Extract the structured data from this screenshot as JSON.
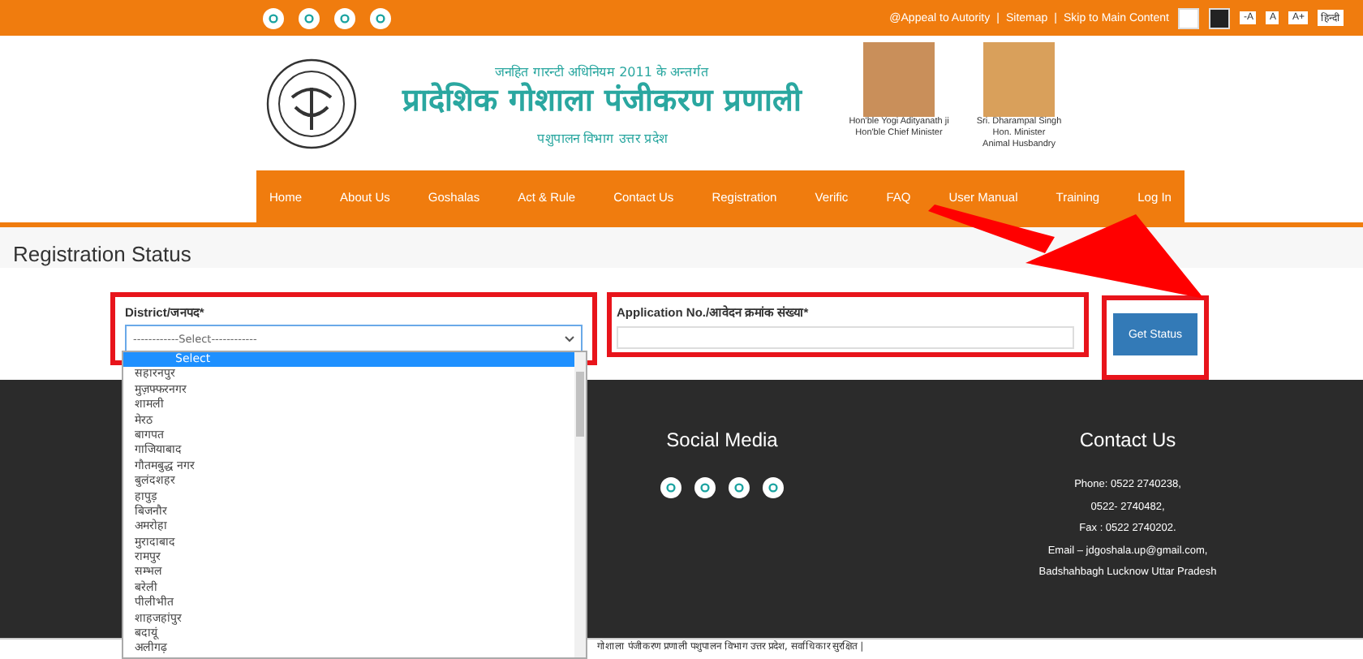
{
  "top_bar": {
    "links": [
      {
        "label": "@Appeal to Autority"
      },
      {
        "label": "Sitemap"
      },
      {
        "label": "Skip to Main Content"
      }
    ],
    "separators": [
      "|",
      "|"
    ],
    "themes": [
      {
        "color": "#ffffff"
      },
      {
        "color": "#222222"
      }
    ],
    "font_buttons": [
      "-A",
      "A",
      "A+"
    ],
    "language": "हिन्दी"
  },
  "header": {
    "act_line": "जनहित गारन्टी अधिनियम 2011 के अन्तर्गत",
    "title": "प्रादेशिक गोशाला पंजीकरण प्रणाली",
    "department": "पशुपालन विभाग उत्तर प्रदेश",
    "officials": [
      {
        "lines": [
          "Hon'ble Yogi Adityanath ji",
          "Hon'ble Chief Minister"
        ]
      },
      {
        "lines": [
          "Sri. Dharampal Singh",
          "Hon. Minister",
          "Animal Husbandry"
        ]
      }
    ]
  },
  "nav": [
    {
      "label": "Home"
    },
    {
      "label": "About Us"
    },
    {
      "label": "Goshalas"
    },
    {
      "label": "Act & Rule"
    },
    {
      "label": "Contact Us"
    },
    {
      "label": "Registration"
    },
    {
      "label": "Verific"
    },
    {
      "label": "FAQ"
    },
    {
      "label": "User Manual"
    },
    {
      "label": "Training"
    },
    {
      "label": "Log In"
    }
  ],
  "page_title": "Registration Status",
  "form": {
    "district": {
      "label": "District/जनपद*",
      "value": "------------Select------------",
      "highlighted": true,
      "expanded": true,
      "options": [
        {
          "label": "Select",
          "selected": true
        },
        {
          "label": "सहारनपुर",
          "selected": false
        },
        {
          "label": "मुज़फ्फरनगर",
          "selected": false
        },
        {
          "label": "शामली",
          "selected": false
        },
        {
          "label": "मेरठ",
          "selected": false
        },
        {
          "label": "बागपत",
          "selected": false
        },
        {
          "label": "गाजियाबाद",
          "selected": false
        },
        {
          "label": "गौतमबुद्ध नगर",
          "selected": false
        },
        {
          "label": "बुलंदशहर",
          "selected": false
        },
        {
          "label": "हापुड़",
          "selected": false
        },
        {
          "label": "बिजनौर",
          "selected": false
        },
        {
          "label": "अमरोहा",
          "selected": false
        },
        {
          "label": "मुरादाबाद",
          "selected": false
        },
        {
          "label": "रामपुर",
          "selected": false
        },
        {
          "label": "सम्भल",
          "selected": false
        },
        {
          "label": "बरेली",
          "selected": false
        },
        {
          "label": "पीलीभीत",
          "selected": false
        },
        {
          "label": "शाहजहांपुर",
          "selected": false
        },
        {
          "label": "बदायूं",
          "selected": false
        },
        {
          "label": "अलीगढ़",
          "selected": false
        }
      ]
    },
    "application": {
      "label": "Application No./आवेदन क्रमांक संख्या*",
      "highlighted": true
    },
    "submit": {
      "label": "Get Status",
      "highlighted": true
    }
  },
  "footer": {
    "social_title": "Social Media",
    "contact_title": "Contact Us",
    "contact_lines": [
      "Phone: 0522 2740238,",
      "0522- 2740482,",
      "Fax : 0522 2740202.",
      "Email – jdgoshala.up@gmail.com,",
      "Badshahbagh Lucknow Uttar Pradesh"
    ],
    "copyright": "गोशाला पंजीकरण प्रणाली पशुपालन विभाग उत्तर प्रदेश, सर्वाधिकार सुरक्षित |"
  }
}
